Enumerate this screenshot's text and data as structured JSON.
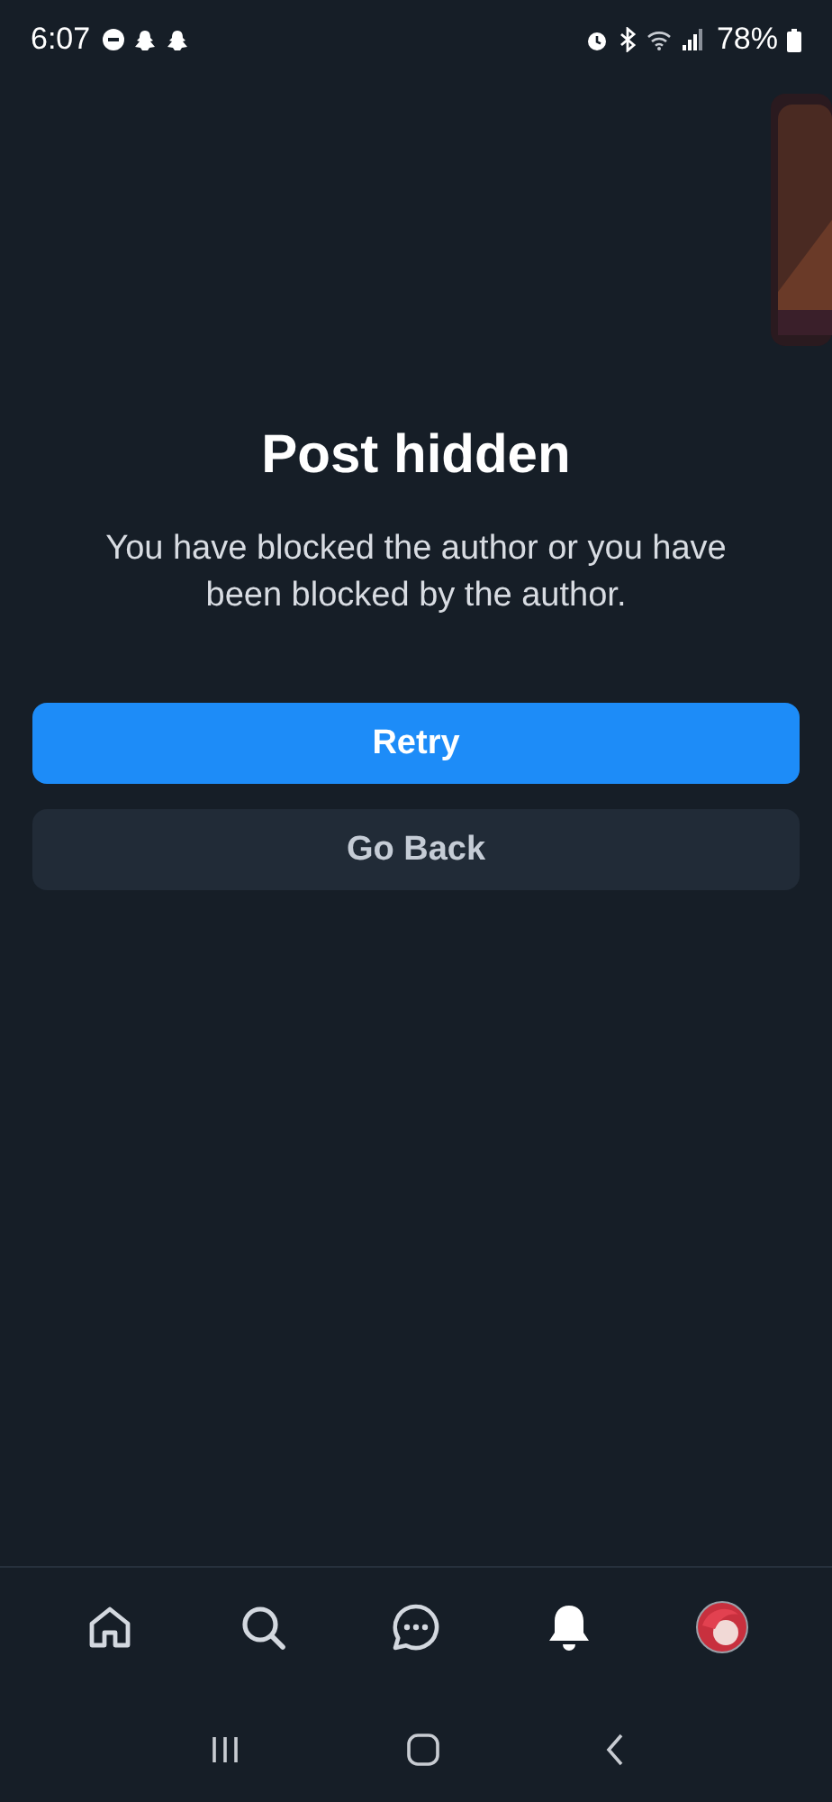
{
  "status_bar": {
    "time": "6:07",
    "battery": "78%"
  },
  "message": {
    "title": "Post hidden",
    "body": "You have blocked the author or you have been blocked by the author."
  },
  "buttons": [
    {
      "label": "Retry",
      "kind": "primary"
    },
    {
      "label": "Go Back",
      "kind": "secondary"
    }
  ],
  "tab_bar": [
    {
      "kind": "home",
      "selected": false
    },
    {
      "kind": "search",
      "selected": false
    },
    {
      "kind": "messages",
      "selected": false
    },
    {
      "kind": "notifications",
      "selected": true
    },
    {
      "kind": "profile",
      "selected": false
    }
  ]
}
